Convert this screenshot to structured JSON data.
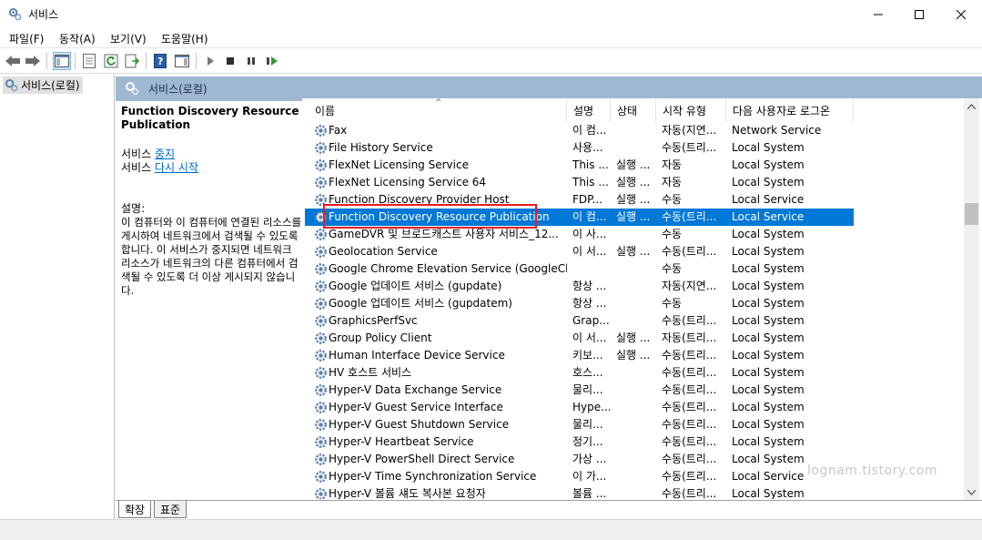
{
  "window": {
    "title": "서비스",
    "app_icon": "gears-icon"
  },
  "menu": [
    {
      "label": "파일(F)"
    },
    {
      "label": "동작(A)"
    },
    {
      "label": "보기(V)"
    },
    {
      "label": "도움말(H)"
    }
  ],
  "toolbar": {
    "icons": [
      "back-arrow-icon",
      "forward-arrow-icon",
      "show-hide-console-tree-icon",
      "properties-icon",
      "refresh-icon",
      "export-list-icon",
      "help-icon",
      "action-pane-icon",
      "start-service-icon",
      "stop-service-icon",
      "pause-service-icon",
      "restart-service-icon"
    ]
  },
  "tree": {
    "root_label": "서비스(로컬)"
  },
  "content": {
    "header_title": "서비스(로컬)",
    "selected_service_title": "Function Discovery Resource Publication",
    "action_prefix_1": "서비스 ",
    "action_link_1": "중지",
    "action_prefix_2": "서비스 ",
    "action_link_2": "다시 시작",
    "description_label": "설명:",
    "description_text": "이 컴퓨터와 이 컴퓨터에 연결된 리소스를 게시하여 네트워크에서 검색될 수 있도록 합니다. 이 서비스가 중지되면 네트워크 리소스가 네트워크의 다른 컴퓨터에서 검색될 수 있도록 더 이상 게시되지 않습니다."
  },
  "columns": [
    "이름",
    "설명",
    "상태",
    "시작 유형",
    "다음 사용자로 로그온"
  ],
  "services": [
    {
      "name": "Fax",
      "desc": "이 컴...",
      "status": "",
      "startup": "자동(지연...",
      "logon": "Network Service"
    },
    {
      "name": "File History Service",
      "desc": "사용...",
      "status": "",
      "startup": "수동(트리...",
      "logon": "Local System"
    },
    {
      "name": "FlexNet Licensing Service",
      "desc": "This ...",
      "status": "실행 ...",
      "startup": "자동",
      "logon": "Local System"
    },
    {
      "name": "FlexNet Licensing Service 64",
      "desc": "This ...",
      "status": "실행 ...",
      "startup": "자동",
      "logon": "Local System"
    },
    {
      "name": "Function Discovery Provider Host",
      "desc": "FDP...",
      "status": "실행 ...",
      "startup": "수동",
      "logon": "Local Service"
    },
    {
      "name": "Function Discovery Resource Publication",
      "desc": "이 컴...",
      "status": "실행 ...",
      "startup": "수동(트리...",
      "logon": "Local Service",
      "selected": true
    },
    {
      "name": "GameDVR 및 브로드캐스트 사용자 서비스_12...",
      "desc": "이 사...",
      "status": "",
      "startup": "수동",
      "logon": "Local System"
    },
    {
      "name": "Geolocation Service",
      "desc": "이 서...",
      "status": "실행 ...",
      "startup": "수동(트리...",
      "logon": "Local System"
    },
    {
      "name": "Google Chrome Elevation Service (GoogleChr...",
      "desc": "",
      "status": "",
      "startup": "수동",
      "logon": "Local System"
    },
    {
      "name": "Google 업데이트 서비스 (gupdate)",
      "desc": "항상 ...",
      "status": "",
      "startup": "자동(지연...",
      "logon": "Local System"
    },
    {
      "name": "Google 업데이트 서비스 (gupdatem)",
      "desc": "항상 ...",
      "status": "",
      "startup": "수동",
      "logon": "Local System"
    },
    {
      "name": "GraphicsPerfSvc",
      "desc": "Grap...",
      "status": "",
      "startup": "수동(트리...",
      "logon": "Local System"
    },
    {
      "name": "Group Policy Client",
      "desc": "이 서...",
      "status": "실행 ...",
      "startup": "자동(트리...",
      "logon": "Local System"
    },
    {
      "name": "Human Interface Device Service",
      "desc": "키보...",
      "status": "실행 ...",
      "startup": "수동(트리...",
      "logon": "Local System"
    },
    {
      "name": "HV 호스트 서비스",
      "desc": "호스...",
      "status": "",
      "startup": "수동(트리...",
      "logon": "Local System"
    },
    {
      "name": "Hyper-V Data Exchange Service",
      "desc": "물리...",
      "status": "",
      "startup": "수동(트리...",
      "logon": "Local System"
    },
    {
      "name": "Hyper-V Guest Service Interface",
      "desc": "Hype...",
      "status": "",
      "startup": "수동(트리...",
      "logon": "Local System"
    },
    {
      "name": "Hyper-V Guest Shutdown Service",
      "desc": "물리...",
      "status": "",
      "startup": "수동(트리...",
      "logon": "Local System"
    },
    {
      "name": "Hyper-V Heartbeat Service",
      "desc": "정기...",
      "status": "",
      "startup": "수동(트리...",
      "logon": "Local System"
    },
    {
      "name": "Hyper-V PowerShell Direct Service",
      "desc": "가상 ...",
      "status": "",
      "startup": "수동(트리...",
      "logon": "Local System"
    },
    {
      "name": "Hyper-V Time Synchronization Service",
      "desc": "이 가...",
      "status": "",
      "startup": "수동(트리...",
      "logon": "Local Service"
    },
    {
      "name": "Hyper-V 볼륨 섀도 복사본 요청자",
      "desc": "볼륨 ...",
      "status": "",
      "startup": "수동(트리...",
      "logon": "Local System"
    }
  ],
  "tabs": [
    {
      "label": "확장",
      "active": true
    },
    {
      "label": "표준",
      "active": false
    }
  ],
  "watermark": "lognam.tistory.com"
}
